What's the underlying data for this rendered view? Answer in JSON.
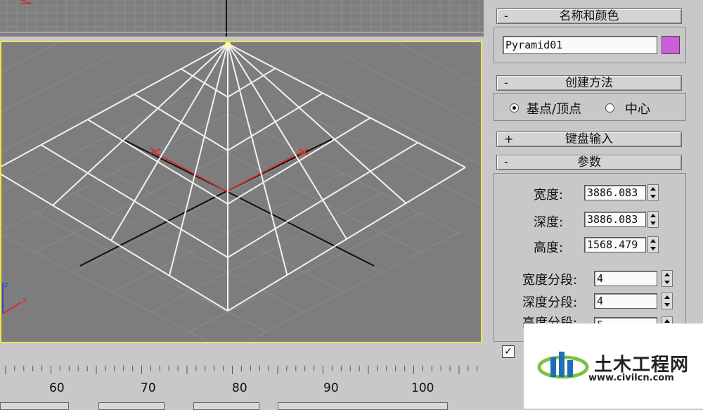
{
  "panel": {
    "name_color": {
      "sign": "-",
      "title": "名称和颜色",
      "object_name": "Pyramid01",
      "swatch_color": "#cc5ed9"
    },
    "creation_method": {
      "sign": "-",
      "title": "创建方法",
      "options": [
        "基点/顶点",
        "中心"
      ],
      "selected": 0
    },
    "keyboard_entry": {
      "sign": "+",
      "title": "键盘输入"
    },
    "parameters": {
      "sign": "-",
      "title": "参数",
      "width_label": "宽度:",
      "width_value": "3886.083",
      "depth_label": "深度:",
      "depth_value": "3886.083",
      "height_label": "高度:",
      "height_value": "1568.479",
      "width_segs_label": "宽度分段:",
      "width_segs_value": "4",
      "depth_segs_label": "深度分段:",
      "depth_segs_value": "4",
      "height_segs_label": "高度分段:",
      "height_segs_value": "5"
    }
  },
  "timeline": {
    "labels": [
      "60",
      "70",
      "80",
      "90",
      "100"
    ]
  },
  "viewport": {
    "axis_labels": [
      "z",
      "x"
    ],
    "border_color": "#f0e64a"
  },
  "watermark": {
    "brand": "土木工程网",
    "url": "www.civilcn.com"
  }
}
